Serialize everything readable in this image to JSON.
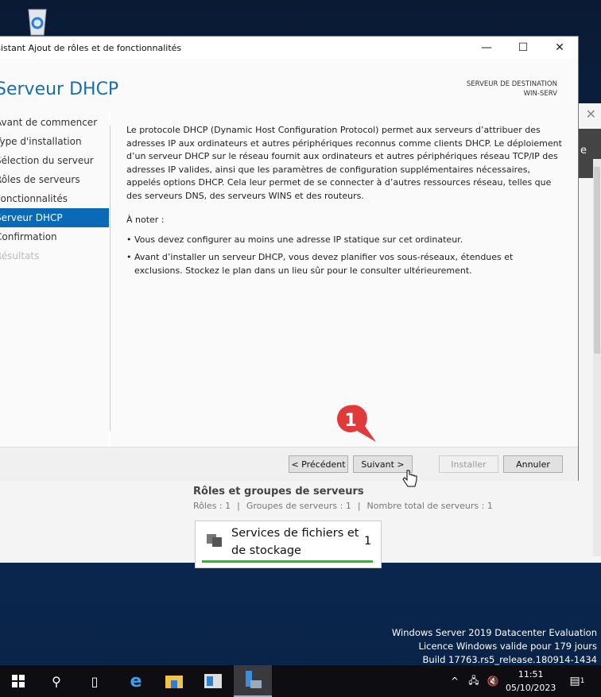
{
  "window": {
    "title": "Assistant Ajout de rôles et de fonctionnalités",
    "minimize_label": "—",
    "maximize_label": "☐",
    "close_label": "✕"
  },
  "header": {
    "page_title": "Serveur DHCP",
    "destination_label": "SERVEUR DE DESTINATION",
    "destination_server": "WIN-SERV"
  },
  "sidebar": {
    "items": [
      {
        "label": "Avant de commencer",
        "state": "normal"
      },
      {
        "label": "Type d'installation",
        "state": "normal"
      },
      {
        "label": "Sélection du serveur",
        "state": "normal"
      },
      {
        "label": "Rôles de serveurs",
        "state": "normal"
      },
      {
        "label": "Fonctionnalités",
        "state": "normal"
      },
      {
        "label": "Serveur DHCP",
        "state": "active"
      },
      {
        "label": "Confirmation",
        "state": "normal"
      },
      {
        "label": "Résultats",
        "state": "disabled"
      }
    ]
  },
  "main": {
    "intro": "Le protocole DHCP (Dynamic Host Configuration Protocol) permet aux serveurs d’attribuer des adresses IP aux ordinateurs et autres périphériques reconnus comme clients DHCP. Le déploiement d’un serveur DHCP sur le réseau fournit aux ordinateurs et autres périphériques réseau TCP/IP des adresses IP valides, ainsi que les paramètres de configuration supplémentaires nécessaires, appelés options DHCP. Cela leur permet de se connecter à d’autres ressources réseau, telles que des serveurs DNS, des serveurs WINS et des routeurs.",
    "note_heading": "À noter :",
    "notes": [
      "Vous devez configurer au moins une adresse IP statique sur cet ordinateur.",
      "Avant d’installer un serveur DHCP, vous devez planifier vos sous-réseaux, étendues et exclusions. Stockez le plan dans un lieu sûr pour le consulter ultérieurement."
    ]
  },
  "footer": {
    "previous": "< Précédent",
    "next": "Suivant >",
    "install": "Installer",
    "cancel": "Annuler"
  },
  "annotation": {
    "step": "1",
    "color": "#e03a3a"
  },
  "background_window": {
    "roles_title": "Rôles et groupes de serveurs",
    "roles_count": "Rôles : 1",
    "groups_count": "Groupes de serveurs : 1",
    "servers_total": "Nombre total de serveurs : 1",
    "separator": "|",
    "tile_name": "Services de fichiers et de stockage",
    "tile_count": "1",
    "dark_letter": "e"
  },
  "desktop": {
    "watermark": [
      "Windows Server 2019 Datacenter Evaluation",
      "Licence Windows valide pour 179 jours",
      "Build 17763.rs5_release.180914-1434"
    ]
  },
  "taskbar": {
    "time": "11:51",
    "date": "05/10/2023",
    "notifications": "1"
  }
}
